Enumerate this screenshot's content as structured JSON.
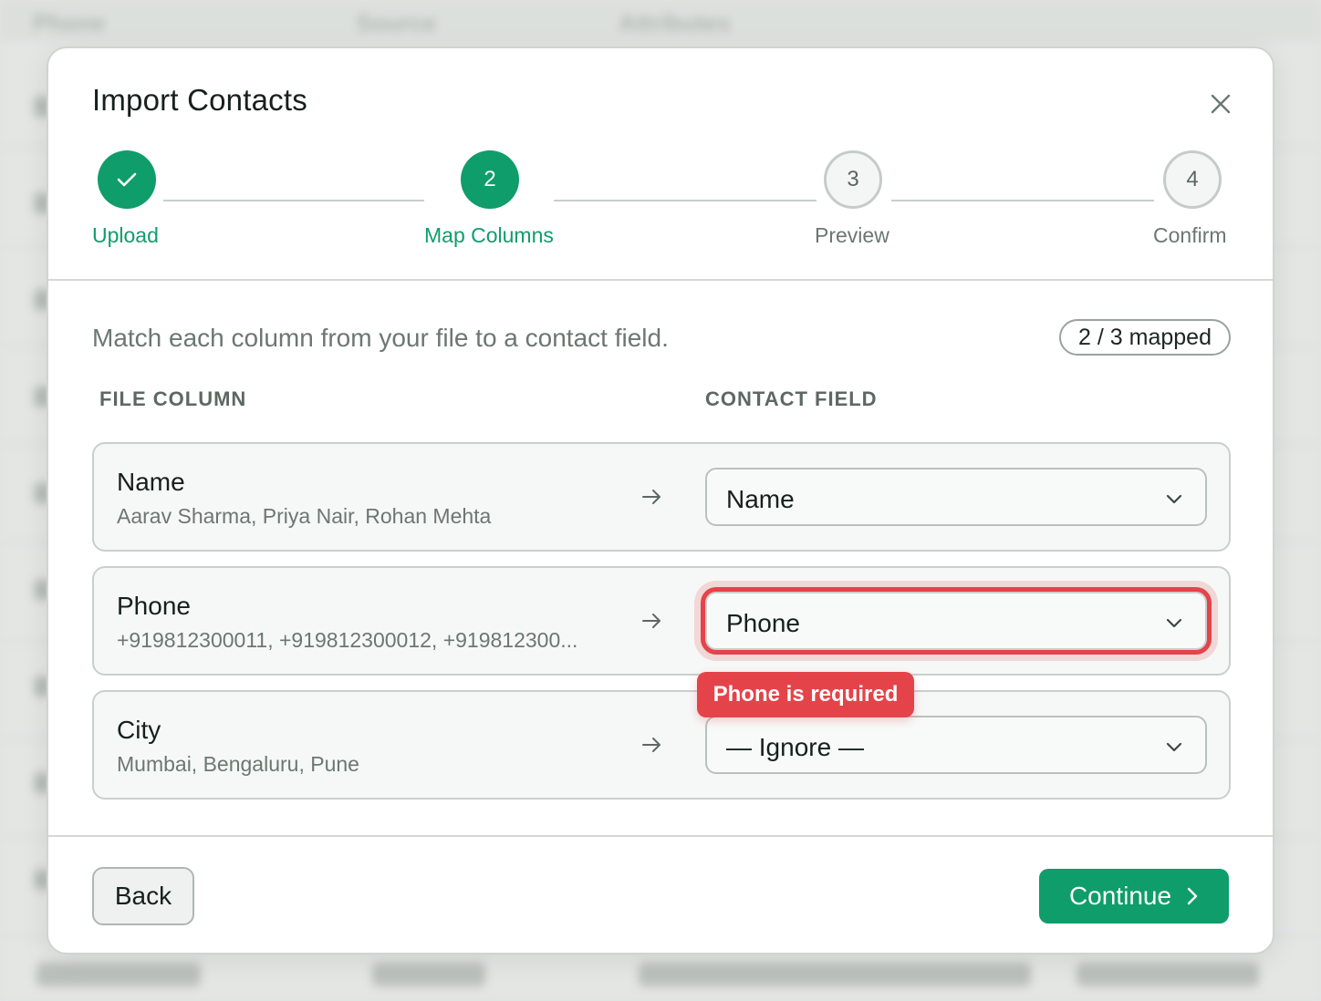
{
  "background": {
    "headers": [
      "Phone",
      "Source",
      "Attributes"
    ]
  },
  "modal": {
    "title": "Import Contacts",
    "steps": [
      {
        "number": "",
        "label": "Upload",
        "state": "done"
      },
      {
        "number": "2",
        "label": "Map Columns",
        "state": "active"
      },
      {
        "number": "3",
        "label": "Preview",
        "state": "pending"
      },
      {
        "number": "4",
        "label": "Confirm",
        "state": "pending"
      }
    ],
    "intro": "Match each column from your file to a contact field.",
    "mapped_badge": "2 / 3 mapped",
    "column_headers": {
      "file": "FILE COLUMN",
      "field": "CONTACT FIELD"
    },
    "rows": [
      {
        "column": "Name",
        "sample": "Aarav Sharma, Priya Nair, Rohan Mehta",
        "field": "Name",
        "error": false
      },
      {
        "column": "Phone",
        "sample": "+919812300011, +919812300012, +919812300...",
        "field": "Phone",
        "error": true
      },
      {
        "column": "City",
        "sample": "Mumbai, Bengaluru, Pune",
        "field": "— Ignore —",
        "error": false
      }
    ],
    "error_message": "Phone is required",
    "buttons": {
      "back": "Back",
      "continue": "Continue"
    }
  },
  "colors": {
    "accent": "#0f9d6b",
    "error": "#e5434a"
  },
  "icons": {
    "close": "close-icon",
    "check": "check-icon",
    "arrow": "arrow-right-icon",
    "chevron": "chevron-down-icon",
    "continue": "chevron-right-icon"
  }
}
